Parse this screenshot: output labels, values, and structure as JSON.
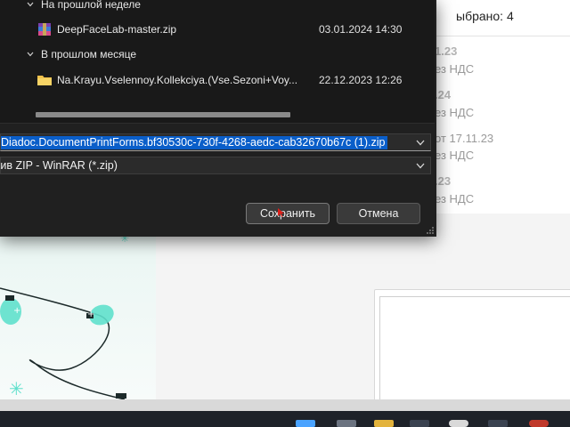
{
  "dialog": {
    "groups": [
      {
        "header": "На прошлой неделе",
        "files": [
          {
            "name": "DeepFaceLab-master.zip",
            "date": "03.01.2024 14:30",
            "icon": "winrar-archive-icon"
          }
        ]
      },
      {
        "header": "В прошлом месяце",
        "files": [
          {
            "name": "Na.Krayu.Vselennoy.Kollekciya.(Vse.Sezoni+Voy...",
            "date": "22.12.2023 12:26",
            "icon": "folder-icon"
          }
        ]
      }
    ],
    "filename_value": "Diadoc.DocumentPrintForms.bf30530c-730f-4268-aedc-cab32670b67c (1).zip",
    "filetype_value": "Архив ZIP - WinRAR (*.zip)",
    "save_label": "Сохранить",
    "cancel_label": "Отмена"
  },
  "background": {
    "selected_text": "ыбрано: 4",
    "entries": [
      {
        "amount": "1.23",
        "note": "ез НДС"
      },
      {
        "amount": ".24",
        "note": "ез НДС"
      },
      {
        "amount": "",
        "note": "от 17.11.23"
      },
      {
        "amount": "",
        "note": "ез НДС"
      },
      {
        "amount": ".23",
        "note": "ез НДС"
      }
    ]
  },
  "colors": {
    "dialog_bg": "#202020",
    "selection": "#0a5ec9",
    "accent_teal": "#3fd6c0"
  }
}
